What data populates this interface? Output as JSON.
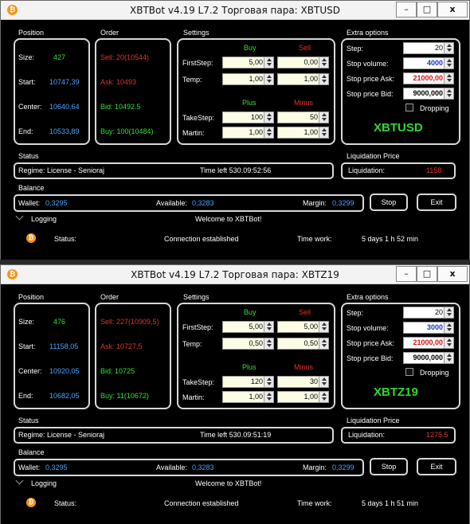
{
  "windows": [
    {
      "title": "XBTBot v4.19 L7.2 Торговая пара: XBTUSD",
      "position": {
        "header": "Position",
        "size_label": "Size:",
        "size": "427",
        "start_label": "Start:",
        "start": "10747,39",
        "center_label": "Center:",
        "center": "10640,64",
        "end_label": "End:",
        "end": "10533,89"
      },
      "order": {
        "header": "Order",
        "sell": "Sell: 20(10544)",
        "ask": "Ask: 10493",
        "bid": "Bid: 10492.5",
        "buy": "Buy: 100(10484)"
      },
      "settings": {
        "header": "Settings",
        "buy_label": "Buy",
        "sell_label": "Sell",
        "firststep_label": "FirstStep:",
        "firststep_buy": "5,00",
        "firststep_sell": "0,00",
        "temp_label": "Temp:",
        "temp_buy": "1,00",
        "temp_sell": "1,00",
        "plus_label": "Plus",
        "minus_label": "Minus",
        "takestep_label": "TakeStep:",
        "takestep_plus": "100",
        "takestep_minus": "50",
        "martin_label": "Martin:",
        "martin_plus": "1,00",
        "martin_minus": "1,00"
      },
      "extra": {
        "header": "Extra options",
        "step_label": "Step:",
        "step": "20",
        "stopvol_label": "Stop volume:",
        "stopvol": "4000",
        "stopask_label": "Stop price Ask:",
        "stopask": "21000,00",
        "stopbid_label": "Stop price Bid:",
        "stopbid": "9000,000",
        "dropping_label": "Dropping",
        "symbol": "XBTUSD"
      },
      "status": {
        "header": "Status",
        "regime": "Regime:  License - Senioraj",
        "time_left": "Time left 530.09:52:56"
      },
      "liquidation": {
        "header": "Liquidation Price",
        "label": "Liquidation:",
        "value": "1158"
      },
      "balance": {
        "header": "Balance",
        "wallet_label": "Wallet:",
        "wallet": "0,3295",
        "available_label": "Available:",
        "available": "0,3283",
        "margin_label": "Margin:",
        "margin": "0,3299"
      },
      "buttons": {
        "stop": "Stop",
        "exit": "Exit"
      },
      "logging": {
        "label": "Logging",
        "message": "Welcome to XBTBot!"
      },
      "statusbar": {
        "status_label": "Status:",
        "status": "Connection established",
        "timework_label": "Time work:",
        "timework": "5 days 1 h 52 min"
      }
    },
    {
      "title": "XBTBot v4.19 L7.2 Торговая пара: XBTZ19",
      "position": {
        "header": "Position",
        "size_label": "Size:",
        "size": "476",
        "start_label": "Start:",
        "start": "11158,05",
        "center_label": "Center:",
        "center": "10920,05",
        "end_label": "End:",
        "end": "10682,05"
      },
      "order": {
        "header": "Order",
        "sell": "Sell: 227(10909,5)",
        "ask": "Ask: 10727.5",
        "bid": "Bid: 10725",
        "buy": "Buy: 11(10672)"
      },
      "settings": {
        "header": "Settings",
        "buy_label": "Buy",
        "sell_label": "Sell",
        "firststep_label": "FirstStep:",
        "firststep_buy": "5,00",
        "firststep_sell": "5,00",
        "temp_label": "Temp:",
        "temp_buy": "0,50",
        "temp_sell": "0,50",
        "plus_label": "Plus",
        "minus_label": "Minus",
        "takestep_label": "TakeStep:",
        "takestep_plus": "120",
        "takestep_minus": "30",
        "martin_label": "Martin:",
        "martin_plus": "1,00",
        "martin_minus": "1,00"
      },
      "extra": {
        "header": "Extra options",
        "step_label": "Step:",
        "step": "20",
        "stopvol_label": "Stop volume:",
        "stopvol": "3000",
        "stopask_label": "Stop price Ask:",
        "stopask": "21000,00",
        "stopbid_label": "Stop price Bid:",
        "stopbid": "9000,000",
        "dropping_label": "Dropping",
        "symbol": "XBTZ19"
      },
      "status": {
        "header": "Status",
        "regime": "Regime:  License - Senioraj",
        "time_left": "Time left 530.09:51:19"
      },
      "liquidation": {
        "header": "Liquidation Price",
        "label": "Liquidation:",
        "value": "1275.5"
      },
      "balance": {
        "header": "Balance",
        "wallet_label": "Wallet:",
        "wallet": "0,3295",
        "available_label": "Available:",
        "available": "0,3283",
        "margin_label": "Margin:",
        "margin": "0,3299"
      },
      "buttons": {
        "stop": "Stop",
        "exit": "Exit"
      },
      "logging": {
        "label": "Logging",
        "message": "Welcome to XBTBot!"
      },
      "statusbar": {
        "status_label": "Status:",
        "status": "Connection established",
        "timework_label": "Time work:",
        "timework": "5 days 1 h 51 min"
      }
    }
  ],
  "window_controls": {
    "minimize": "–",
    "maximize": "□",
    "close": "x"
  },
  "colors": {
    "positive": "#2ee52e",
    "negative": "#e0352a",
    "info": "#4aa3ff",
    "bitcoin": "#f7931a"
  }
}
